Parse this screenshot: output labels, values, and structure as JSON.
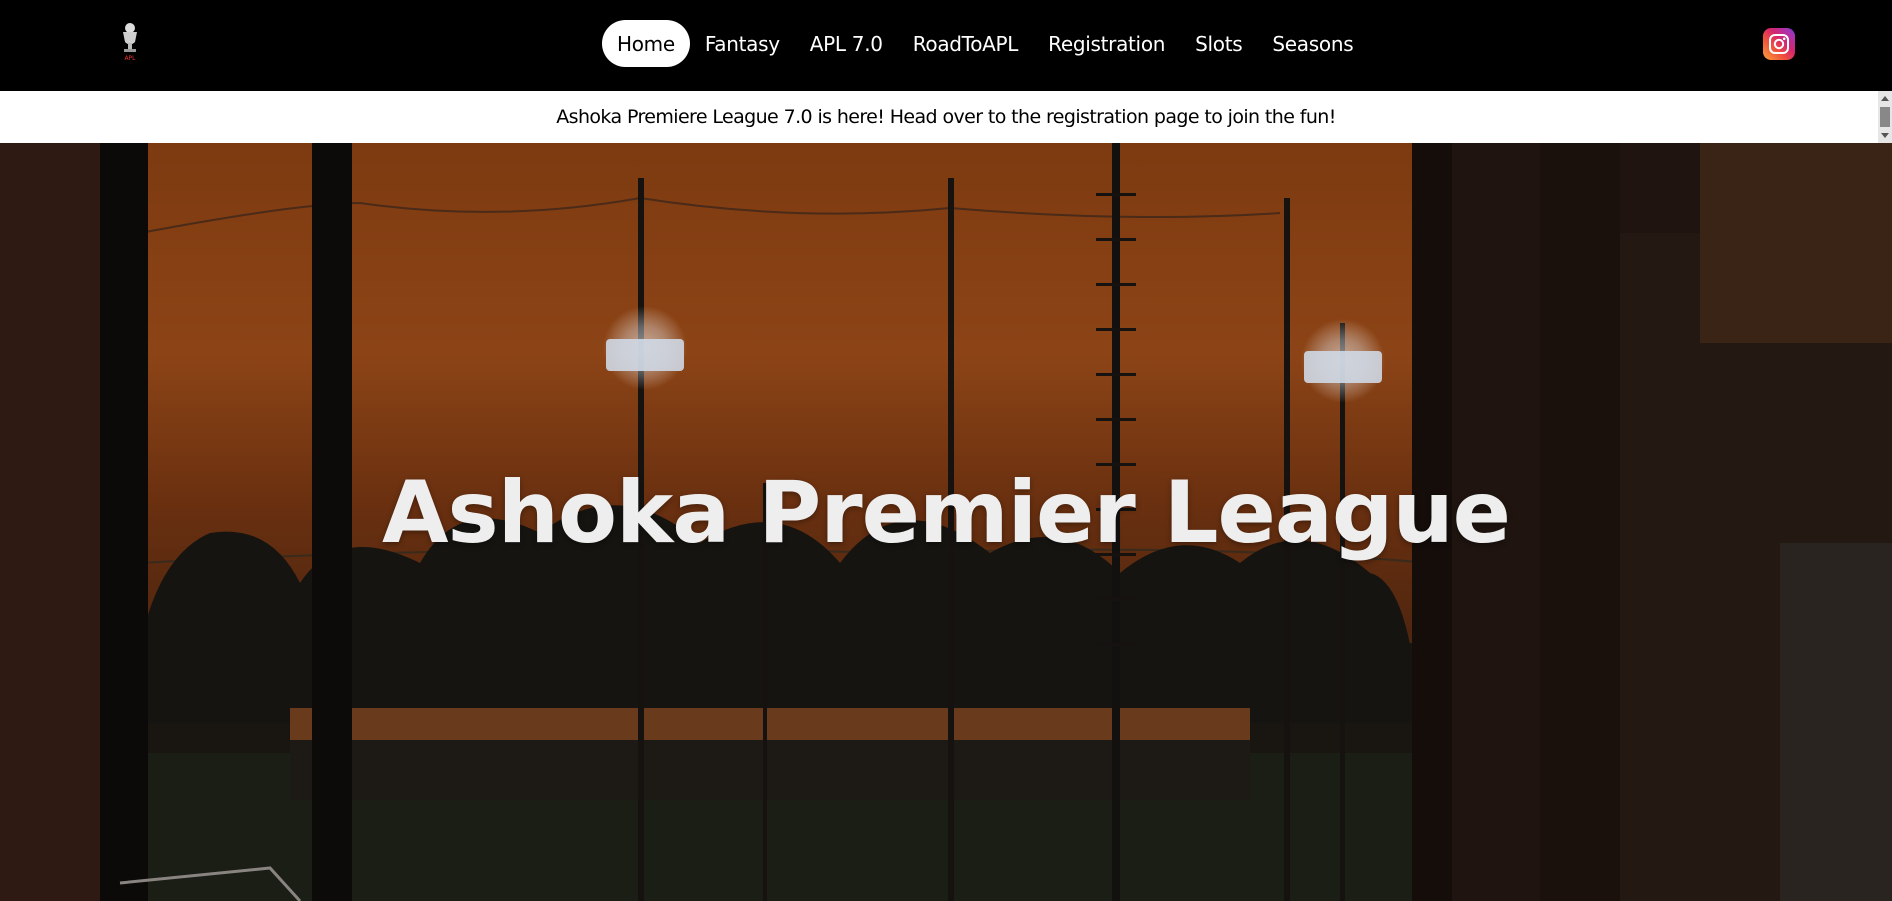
{
  "nav": {
    "logo_icon": "trophy-logo-icon",
    "logo_text": "APL",
    "links": [
      "Home",
      "Fantasy",
      "APL 7.0",
      "RoadToAPL",
      "Registration",
      "Slots",
      "Seasons"
    ],
    "active": "Home",
    "social_icon": "instagram-icon"
  },
  "announcement": {
    "text": "Ashoka Premiere League 7.0 is here! Head over to the registration page to join the fun!"
  },
  "hero": {
    "title": "Ashoka Premier League"
  }
}
